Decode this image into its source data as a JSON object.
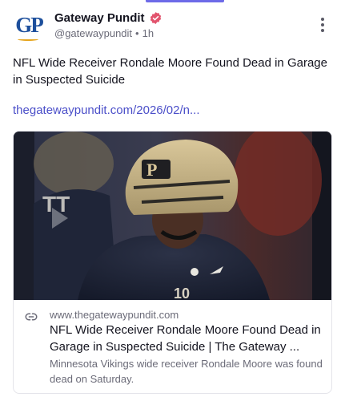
{
  "post": {
    "author": {
      "name": "Gateway Pundit",
      "handle": "@gatewaypundit",
      "time": "1h",
      "avatar_text": "GP"
    },
    "separator": "•",
    "text": "NFL Wide Receiver Rondale Moore Found Dead in Garage in Suspected Suicide",
    "link": "thegatewaypundit.com/2026/02/n..."
  },
  "link_card": {
    "domain": "www.thegatewaypundit.com",
    "title": "NFL Wide Receiver Rondale Moore Found Dead in Garage in Suspected Suicide | The Gateway ...",
    "description": "Minnesota Vikings wide receiver Rondale Moore was found dead on Saturday."
  },
  "icons": {
    "verified": "verified-badge-icon",
    "more": "more-vertical-icon",
    "link": "link-icon"
  },
  "colors": {
    "accent": "#6d6ae8",
    "link": "#4b4fc9",
    "verified": "#e2536d",
    "brand_blue": "#1d4f9c"
  }
}
